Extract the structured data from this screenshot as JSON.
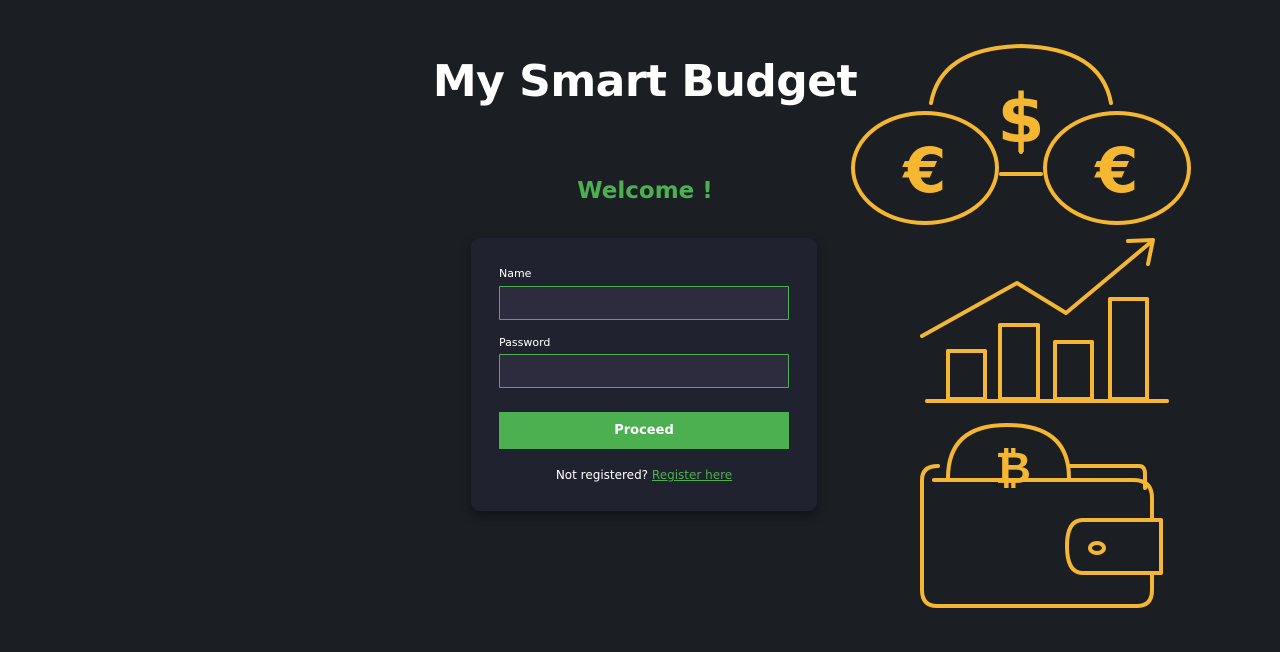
{
  "header": {
    "title": "My Smart Budget"
  },
  "login": {
    "welcome": "Welcome !",
    "name_label": "Name",
    "name_value": "",
    "password_label": "Password",
    "password_value": "",
    "proceed_label": "Proceed",
    "register_prompt": "Not registered?",
    "register_link": "Register here"
  },
  "illustration": {
    "icons": [
      "coins-icon",
      "growth-chart-icon",
      "wallet-icon"
    ],
    "coin_symbols": [
      "$",
      "€",
      "€",
      "₿"
    ],
    "color": "#f5b731"
  },
  "colors": {
    "background": "#1b1f24",
    "card": "#212230",
    "input": "#2c2c3e",
    "accent": "#4caf50",
    "illustration": "#f5b731"
  }
}
